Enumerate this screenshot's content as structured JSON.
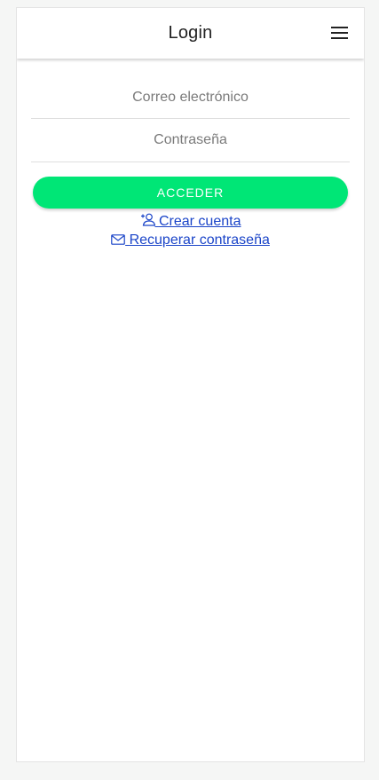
{
  "header": {
    "title": "Login",
    "menu_icon": "menu-icon"
  },
  "form": {
    "email_placeholder": "Correo electrónico",
    "password_placeholder": "Contraseña",
    "submit_label": "ACCEDER"
  },
  "links": {
    "create_account": "Crear cuenta",
    "create_account_icon": "person-add-icon",
    "recover_password": "Recuperar contraseña",
    "recover_password_icon": "mail-icon"
  },
  "colors": {
    "accent": "#00e676",
    "link": "#1a44c8"
  }
}
